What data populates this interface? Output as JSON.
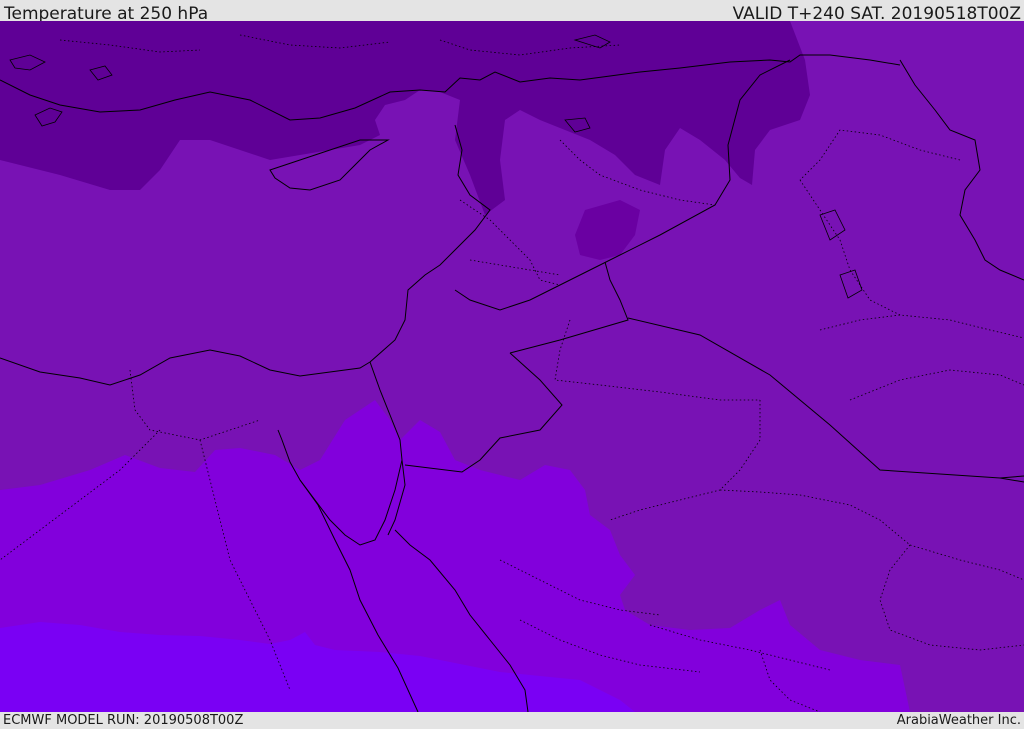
{
  "header": {
    "title": "Temperature at 250 hPa",
    "valid_time": "VALID T+240 SAT. 20190518T00Z"
  },
  "footer": {
    "model_run": "ECMWF MODEL RUN: 20190508T00Z",
    "credit": "ArabiaWeather Inc."
  },
  "map": {
    "variable": "temperature",
    "level": "250 hPa",
    "colors": {
      "coldest": "#5f0096",
      "cold": "#6a00a2",
      "mid": "#7812b4",
      "warm": "#8200dc",
      "warmest": "#7a00f4",
      "border": "#000000"
    }
  }
}
